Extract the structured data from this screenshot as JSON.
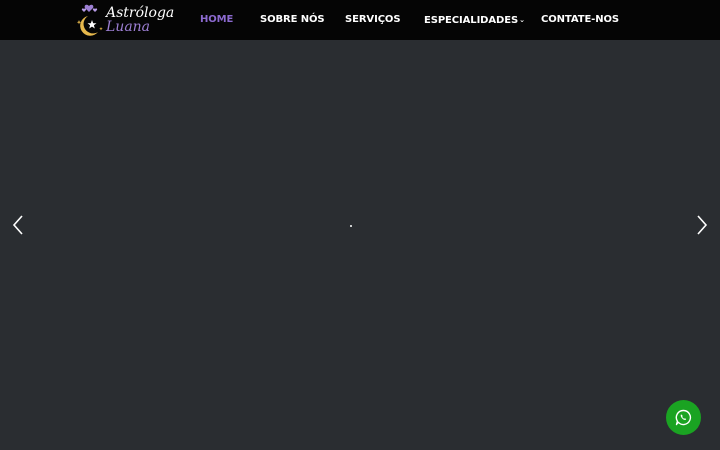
{
  "brand": {
    "line1": "Astróloga",
    "line2": "Luana",
    "colors": {
      "primary": "#9d7fd4",
      "accent": "#e6b84c"
    },
    "icons": [
      "hearts-icon",
      "moon-star-icon"
    ]
  },
  "nav": {
    "items": [
      {
        "label": "HOME",
        "active": true
      },
      {
        "label": "SOBRE NÓS",
        "active": false
      },
      {
        "label": "SERVIÇOS",
        "active": false
      },
      {
        "label": "ESPECIALIDADES",
        "active": false,
        "has_dropdown": true
      },
      {
        "label": "CONTATE-NOS",
        "active": false
      }
    ],
    "active_color": "#8c6ad0",
    "dropdown_icon": "chevron-down-icon"
  },
  "slider": {
    "prev_icon": "chevron-left-icon",
    "next_icon": "chevron-right-icon",
    "background": "#2a2d31"
  },
  "whatsapp": {
    "icon": "whatsapp-icon",
    "color": "#1aa322"
  }
}
